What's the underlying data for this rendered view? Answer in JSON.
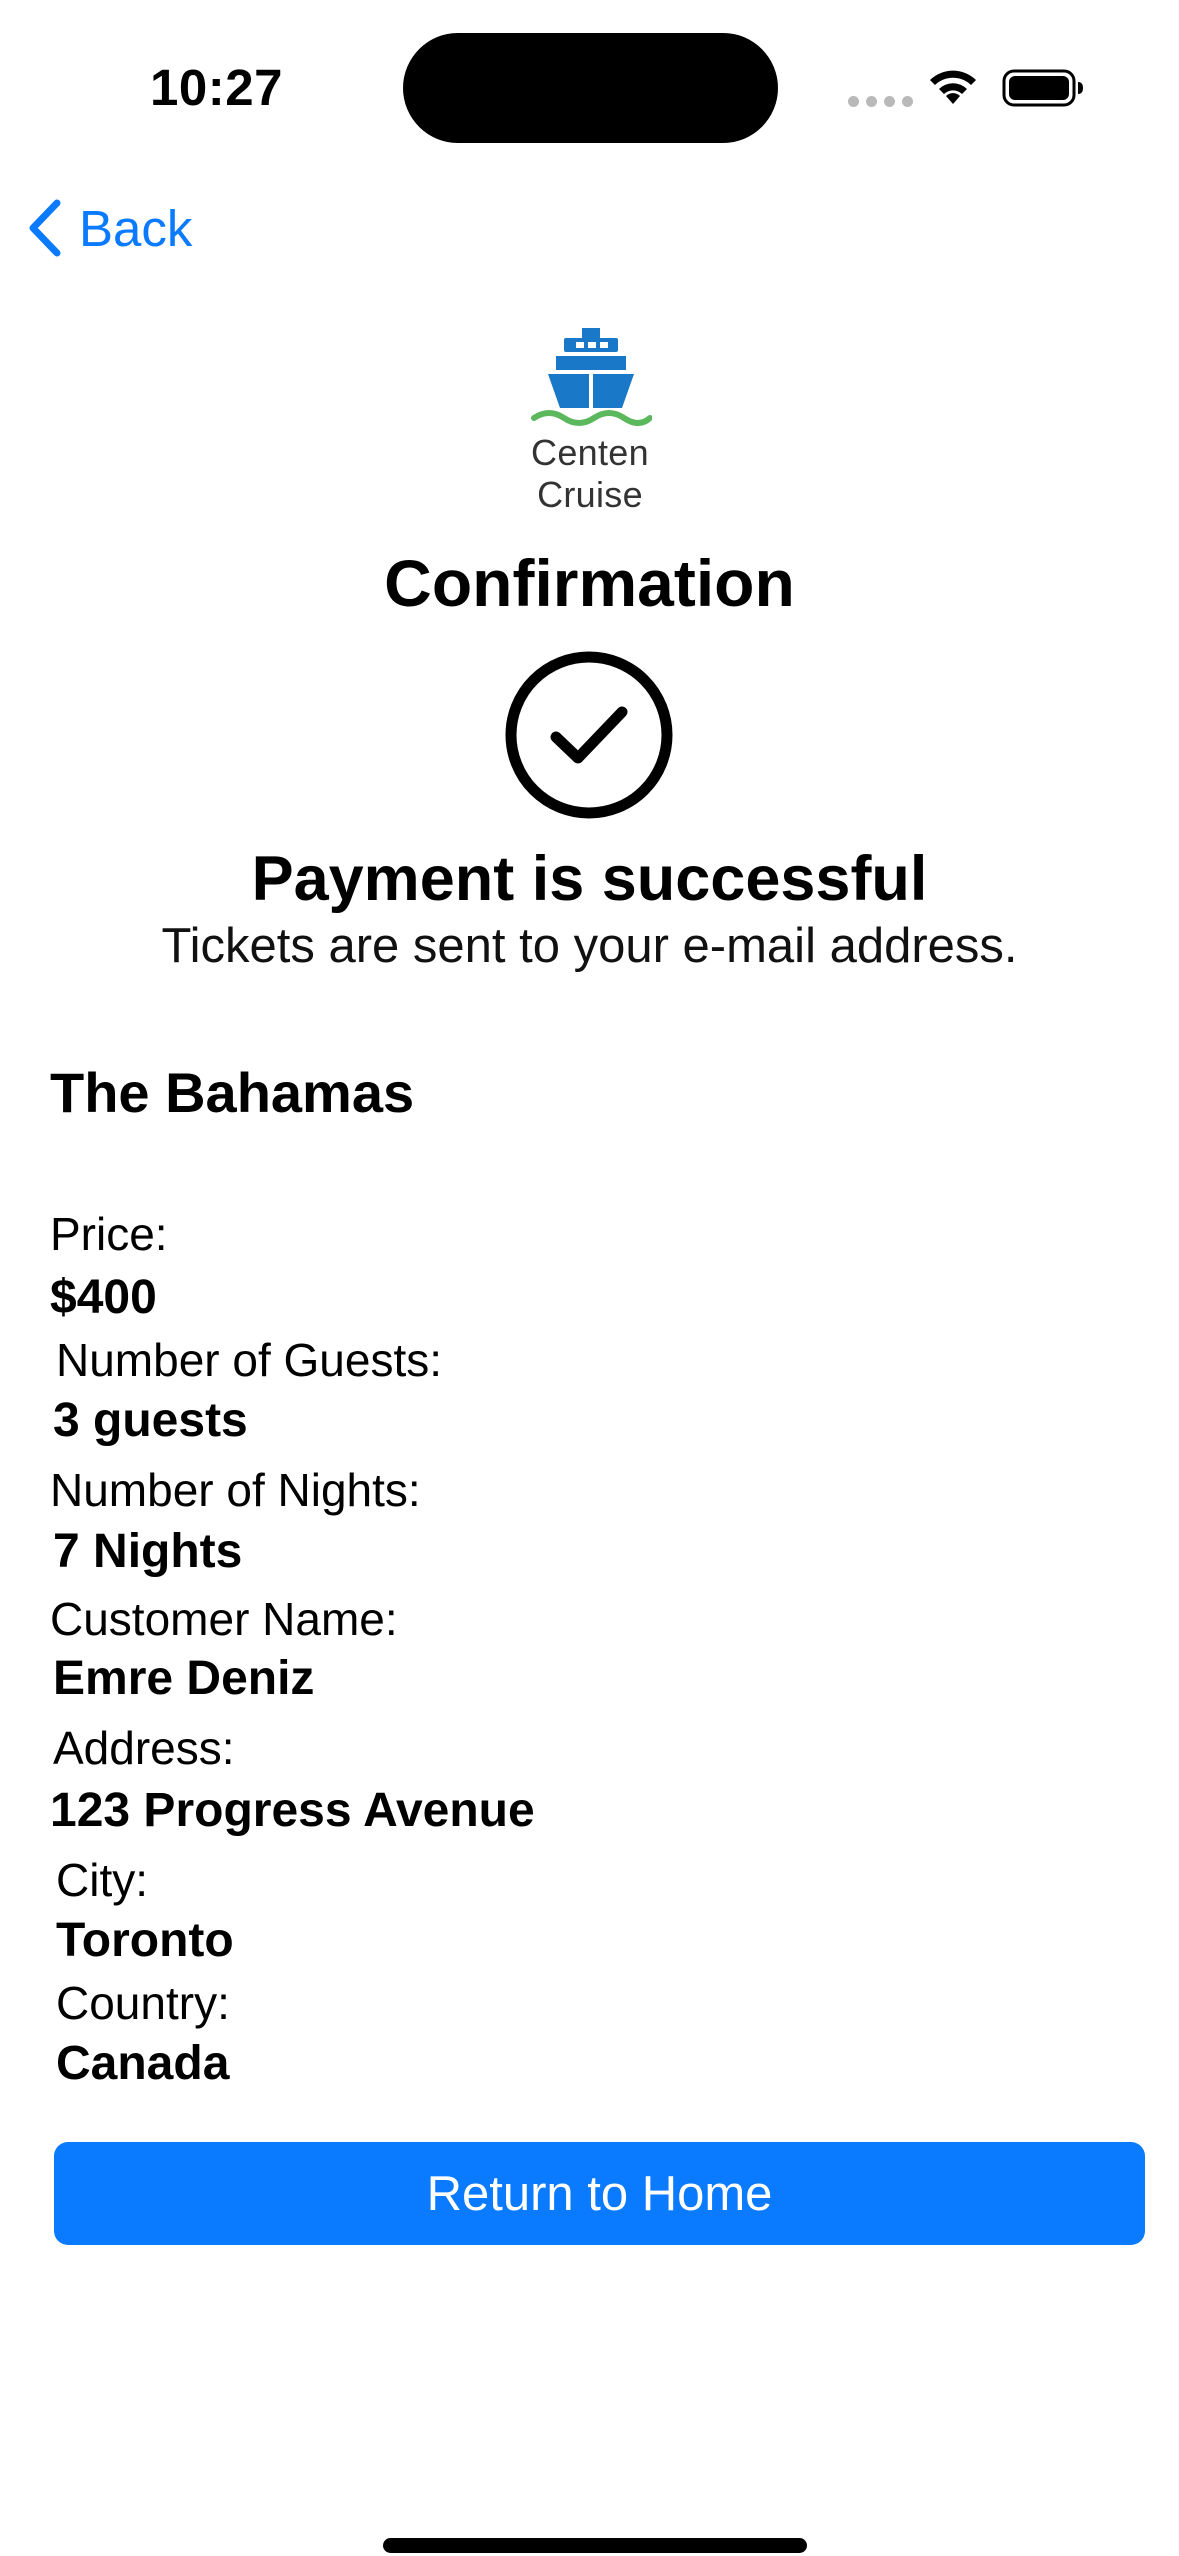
{
  "status_bar": {
    "time": "10:27"
  },
  "nav": {
    "back_label": "Back"
  },
  "logo": {
    "name": "Centen Cruise"
  },
  "header": {
    "title": "Confirmation",
    "success_heading": "Payment is successful",
    "success_subtext": "Tickets are sent to your e-mail address."
  },
  "details": {
    "destination": "The Bahamas",
    "price_label": "Price:",
    "price_value": "$400",
    "guests_label": "Number of Guests:",
    "guests_value": "3 guests",
    "nights_label": "Number of Nights:",
    "nights_value": "7 Nights",
    "customer_label": "Customer Name:",
    "customer_value": "Emre Deniz",
    "address_label": "Address:",
    "address_value": "123 Progress Avenue",
    "city_label": "City:",
    "city_value": "Toronto",
    "country_label": "Country:",
    "country_value": "Canada"
  },
  "actions": {
    "return_home_label": "Return to Home"
  },
  "colors": {
    "accent": "#0a7aff",
    "logo_ship": "#1a78c8",
    "logo_waves": "#5cb85c"
  }
}
